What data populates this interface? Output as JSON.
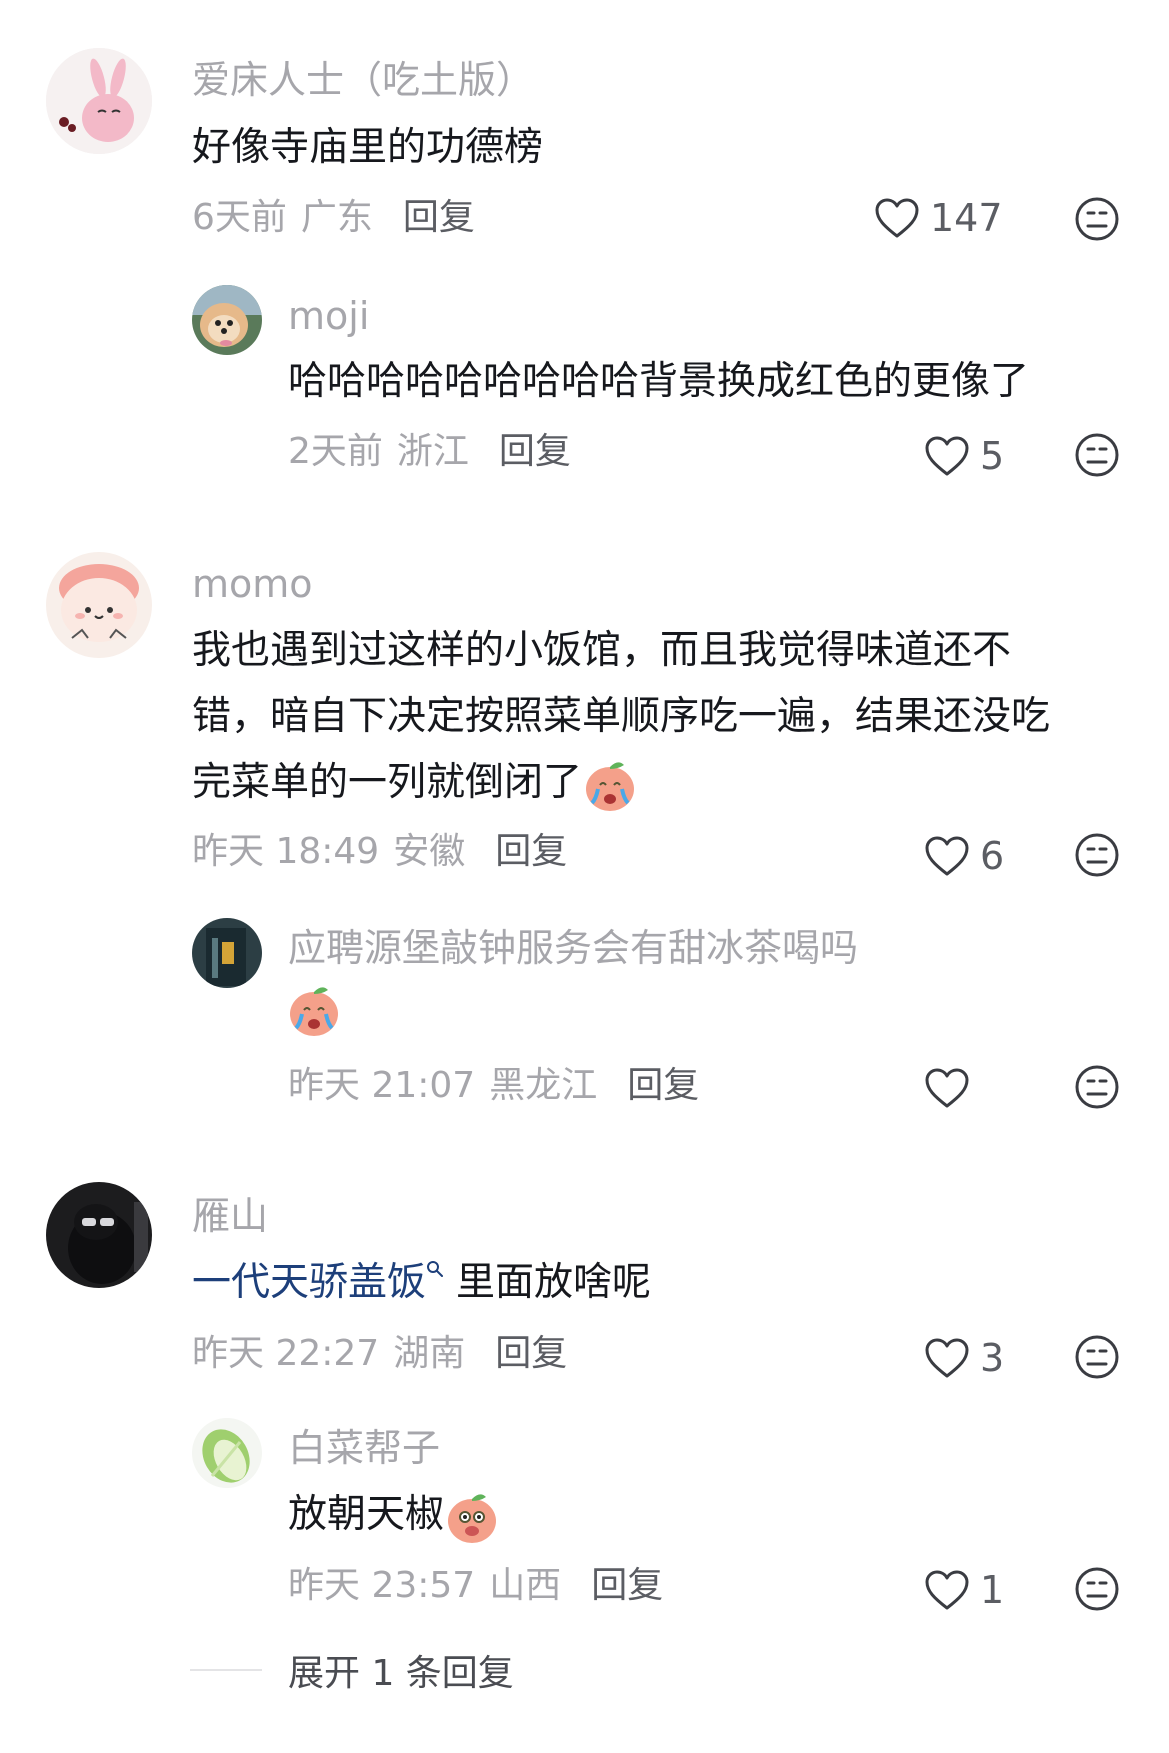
{
  "comments": [
    {
      "username": "爱床人士（吃土版）",
      "text": "好像寺庙里的功德榜",
      "time": "6天前",
      "location": "广东",
      "reply_label": "回复",
      "likes": "147",
      "replies": [
        {
          "username": "moji",
          "text": "哈哈哈哈哈哈哈哈哈背景换成红色的更像了",
          "time": "2天前",
          "location": "浙江",
          "reply_label": "回复",
          "likes": "5"
        }
      ]
    },
    {
      "username": "momo",
      "text_lines": [
        "我也遇到过这样的小饭馆，而且我觉得味道还不",
        "错，暗自下决定按照菜单顺序吃一遍，结果还没吃",
        "完菜单的一列就倒闭了"
      ],
      "time": "昨天 18:49",
      "location": "安徽",
      "reply_label": "回复",
      "likes": "6",
      "replies": [
        {
          "username": "应聘源堡敲钟服务会有甜冰茶喝吗",
          "time": "昨天 21:07",
          "location": "黑龙江",
          "reply_label": "回复",
          "likes": ""
        }
      ]
    },
    {
      "username": "雁山",
      "link_text": "一代天骄盖饭",
      "text": "里面放啥呢",
      "time": "昨天 22:27",
      "location": "湖南",
      "reply_label": "回复",
      "likes": "3",
      "replies": [
        {
          "username": "白菜帮子",
          "text": "放朝天椒",
          "time": "昨天 23:57",
          "location": "山西",
          "reply_label": "回复",
          "likes": "1"
        }
      ]
    }
  ],
  "expand_replies_label": "展开 1 条回复",
  "icons": {
    "like": "heart-outline-icon",
    "dislike": "meh-face-icon",
    "search": "search-icon",
    "emoji": "crying-peach-emoji"
  },
  "colors": {
    "text": "#16181d",
    "muted": "#a6a6ab",
    "link": "#1d3f7a",
    "action": "#5b5d63"
  }
}
